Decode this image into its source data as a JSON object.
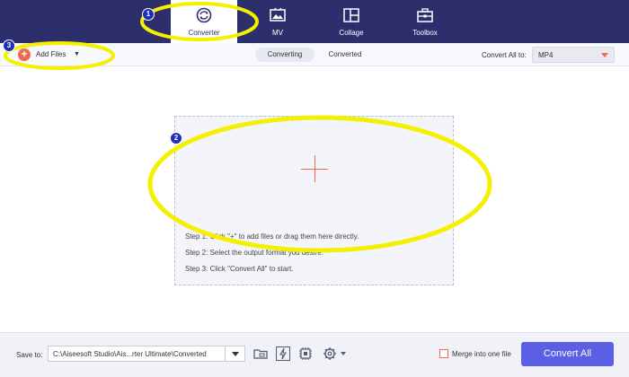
{
  "nav": {
    "tabs": [
      {
        "label": "Converter",
        "icon": "converter-icon",
        "active": true
      },
      {
        "label": "MV",
        "icon": "mv-icon",
        "active": false
      },
      {
        "label": "Collage",
        "icon": "collage-icon",
        "active": false
      },
      {
        "label": "Toolbox",
        "icon": "toolbox-icon",
        "active": false
      }
    ]
  },
  "toolbar": {
    "add_files_label": "Add Files",
    "tabs": [
      {
        "label": "Converting",
        "active": true
      },
      {
        "label": "Converted",
        "active": false
      }
    ],
    "convert_all_to_label": "Convert All to:",
    "format_value": "MP4"
  },
  "dropzone": {
    "steps": [
      "Step 1: Click \"+\" to add files or drag them here directly.",
      "Step 2: Select the output format you desire.",
      "Step 3: Click \"Convert All\" to start."
    ]
  },
  "bottom": {
    "save_to_label": "Save to:",
    "save_path": "C:\\Aiseesoft Studio\\Ais...rter Ultimate\\Converted",
    "merge_label": "Merge into one file",
    "convert_all_button": "Convert All"
  },
  "annotations": {
    "badges": [
      "1",
      "2",
      "3"
    ],
    "highlight_color": "#f5f000"
  },
  "colors": {
    "nav_bg": "#2c2f6b",
    "accent_orange": "#ef6a4a",
    "primary_button": "#5b5fe6"
  }
}
